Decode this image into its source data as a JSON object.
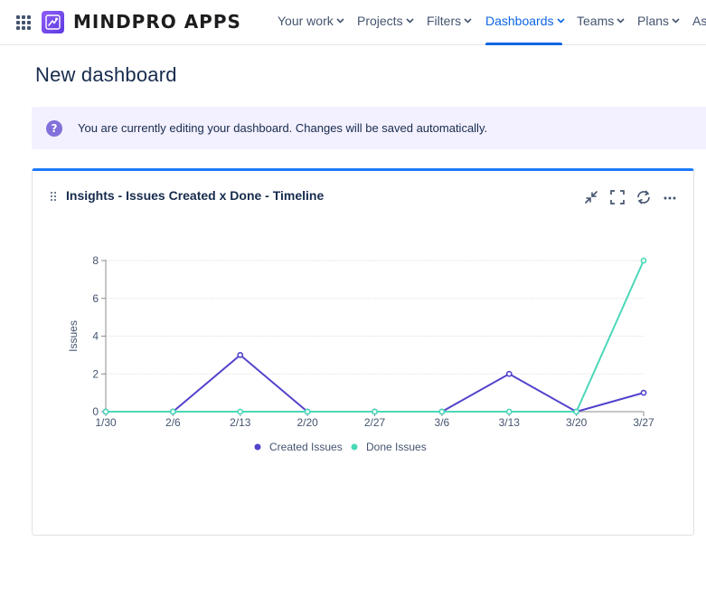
{
  "header": {
    "brand": "MINDPRO APPS",
    "nav": [
      {
        "label": "Your work",
        "active": false
      },
      {
        "label": "Projects",
        "active": false
      },
      {
        "label": "Filters",
        "active": false
      },
      {
        "label": "Dashboards",
        "active": true
      },
      {
        "label": "Teams",
        "active": false
      },
      {
        "label": "Plans",
        "active": false
      },
      {
        "label": "As",
        "active": false
      }
    ]
  },
  "page": {
    "title": "New dashboard"
  },
  "banner": {
    "icon": "question-icon",
    "message": "You are currently editing your dashboard. Changes will be saved automatically."
  },
  "gadget": {
    "title": "Insights - Issues Created x Done - Timeline",
    "icons": [
      "minimize-icon",
      "fullscreen-icon",
      "refresh-icon",
      "more-icon"
    ]
  },
  "colors": {
    "accent": "#0c66e4",
    "created": "#5243cc",
    "done": "#4bd8b8",
    "banner_bg": "#f3f0ff"
  },
  "chart_data": {
    "type": "line",
    "categories": [
      "1/30",
      "2/6",
      "2/13",
      "2/20",
      "2/27",
      "3/6",
      "3/13",
      "3/20",
      "3/27"
    ],
    "series": [
      {
        "name": "Created Issues",
        "values": [
          0,
          0,
          3,
          0,
          0,
          0,
          2,
          0,
          1
        ]
      },
      {
        "name": "Done Issues",
        "values": [
          0,
          0,
          0,
          0,
          0,
          0,
          0,
          0,
          8
        ]
      }
    ],
    "ylabel": "Issues",
    "xlabel": "",
    "ylim": [
      0,
      8
    ],
    "yticks": [
      0,
      2,
      4,
      6,
      8
    ],
    "grid": true,
    "legend": "bottom"
  }
}
